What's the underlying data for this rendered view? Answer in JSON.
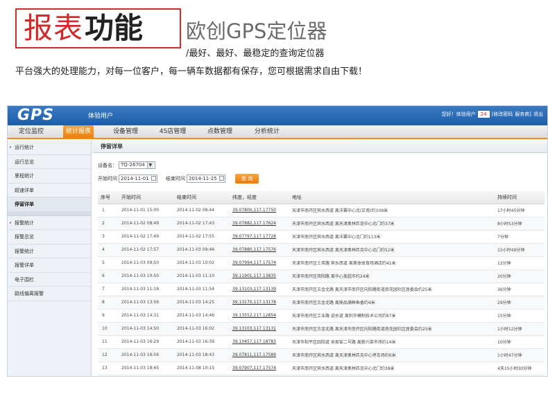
{
  "promo": {
    "title_a": "报表",
    "title_b": "功能",
    "brand": "欧创GPS定位器",
    "tagline": "/最好、最好、最稳定的查询定位器",
    "description": "平台强大的处理能力，对每一位客户，每一辆车数据都有保存，您可根据需求自由下载！"
  },
  "app": {
    "logo": "GPS",
    "username": "体验用户",
    "greeting": "您好！体验用户",
    "badge_count": "24",
    "change_password": "[修改密码",
    "service": "服务商]",
    "logout": "退出"
  },
  "nav": {
    "tabs": [
      {
        "label": "定位监控"
      },
      {
        "label": "统计报表"
      },
      {
        "label": "设备管理"
      },
      {
        "label": "4S店管理"
      },
      {
        "label": "点数管理"
      },
      {
        "label": "分析统计"
      }
    ],
    "active_index": 1
  },
  "sidebar": {
    "group1": [
      {
        "label": "运行统计"
      },
      {
        "label": "运行总览"
      },
      {
        "label": "里程统计"
      },
      {
        "label": "超速详单"
      },
      {
        "label": "停留详单"
      }
    ],
    "group2": [
      {
        "label": "报警统计"
      },
      {
        "label": "报警总览"
      },
      {
        "label": "报警统计"
      },
      {
        "label": "报警详单"
      },
      {
        "label": "电子围栏"
      },
      {
        "label": "路线偏离报警"
      }
    ]
  },
  "panel": {
    "title": "停留详单",
    "device_label": "设备名：",
    "device_value": "TQ-26704",
    "start_label": "开始时间",
    "start_value": "2014-11-01",
    "end_label": "结束时间",
    "end_value": "2014-11-25",
    "query_button": "查 询"
  },
  "table": {
    "headers": [
      "序号",
      "开始时间",
      "结束时间",
      "纬度，经度",
      "地址",
      "持续时间"
    ],
    "rows": [
      [
        "1",
        "2014-11-01 15:00",
        "2014-11-02 08:44",
        "39.07800,117.17750",
        "天津市南开区宾水西道 离洋翼中心北(正南)约109米",
        "17小时45分钟"
      ],
      [
        "2",
        "2014-11-02 08:49",
        "2014-11-02 17:43",
        "39.07882,117.17624",
        "天津市南开区宾水西道 离天津奥林匹克中心北门约37米",
        "8小时53分钟"
      ],
      [
        "3",
        "2014-11-02 17:49",
        "2014-11-02 17:55",
        "39.07797,117.17728",
        "天津市南开区宾水西道 离洋翼中心北门约113米",
        "7分钟"
      ],
      [
        "4",
        "2014-11-02 17:57",
        "2014-11-03 09:46",
        "39.07880,117.17576",
        "天津市南开区宾水西道 离天津奥林匹克中心北门约52米",
        "15小时49分钟"
      ],
      [
        "5",
        "2014-11-03 09:50",
        "2014-11-03 10:02",
        "39.07994,117.17574",
        "天津市南开区士英路 宾水西道 离奥体体育场酒店约41米",
        "12分钟"
      ],
      [
        "6",
        "2014-11-03 10:50",
        "2014-11-03 11:10",
        "39.11901,117.13835",
        "天津市南开区简阳路 离华心美超市约24米",
        "20分钟"
      ],
      [
        "7",
        "2014-11-03 11:18",
        "2014-11-03 11:54",
        "39.13103,117.13139",
        "天津市南开区古金北路 离天津市南开区向阳路街道南花园社区居委会约25米",
        "36分钟"
      ],
      [
        "8",
        "2014-11-03 13:56",
        "2014-11-03 14:25",
        "39.13170,117.13178",
        "天津市南开区古金北路 离鼎品满鲜鱼香约4米",
        "29分钟"
      ],
      [
        "9",
        "2014-11-03 14:31",
        "2014-11-03 14:46",
        "39.13552,117.12854",
        "天津市南开区工业路 迎水道 离利华模制技术公司约87米",
        "15分钟"
      ],
      [
        "10",
        "2014-11-03 14:50",
        "2014-11-03 16:02",
        "39.13103,117.13131",
        "天津市南开区古金北路 离天津市南开区向阳路街道南花园社区居委会约25米",
        "1小时12分钟"
      ],
      [
        "11",
        "2014-11-03 16:29",
        "2014-11-03 16:39",
        "39.10457,117.18783",
        "天津市和平区四阳道 吴家窑二号路 离新兴菜市场约14米",
        "10分钟"
      ],
      [
        "12",
        "2014-11-03 16:56",
        "2014-11-03 18:43",
        "39.07811,117.17589",
        "天津市南开区宾水西道 离天津奥林匹克中心停车场约6米",
        "1小时47分钟"
      ],
      [
        "13",
        "2014-11-03 18:45",
        "2014-11-08 10:15",
        "39.07907,117.17574",
        "天津市南开区宾水西道 离天津奥林匹克中心北门约38米",
        "4天15小时30分钟"
      ]
    ]
  }
}
